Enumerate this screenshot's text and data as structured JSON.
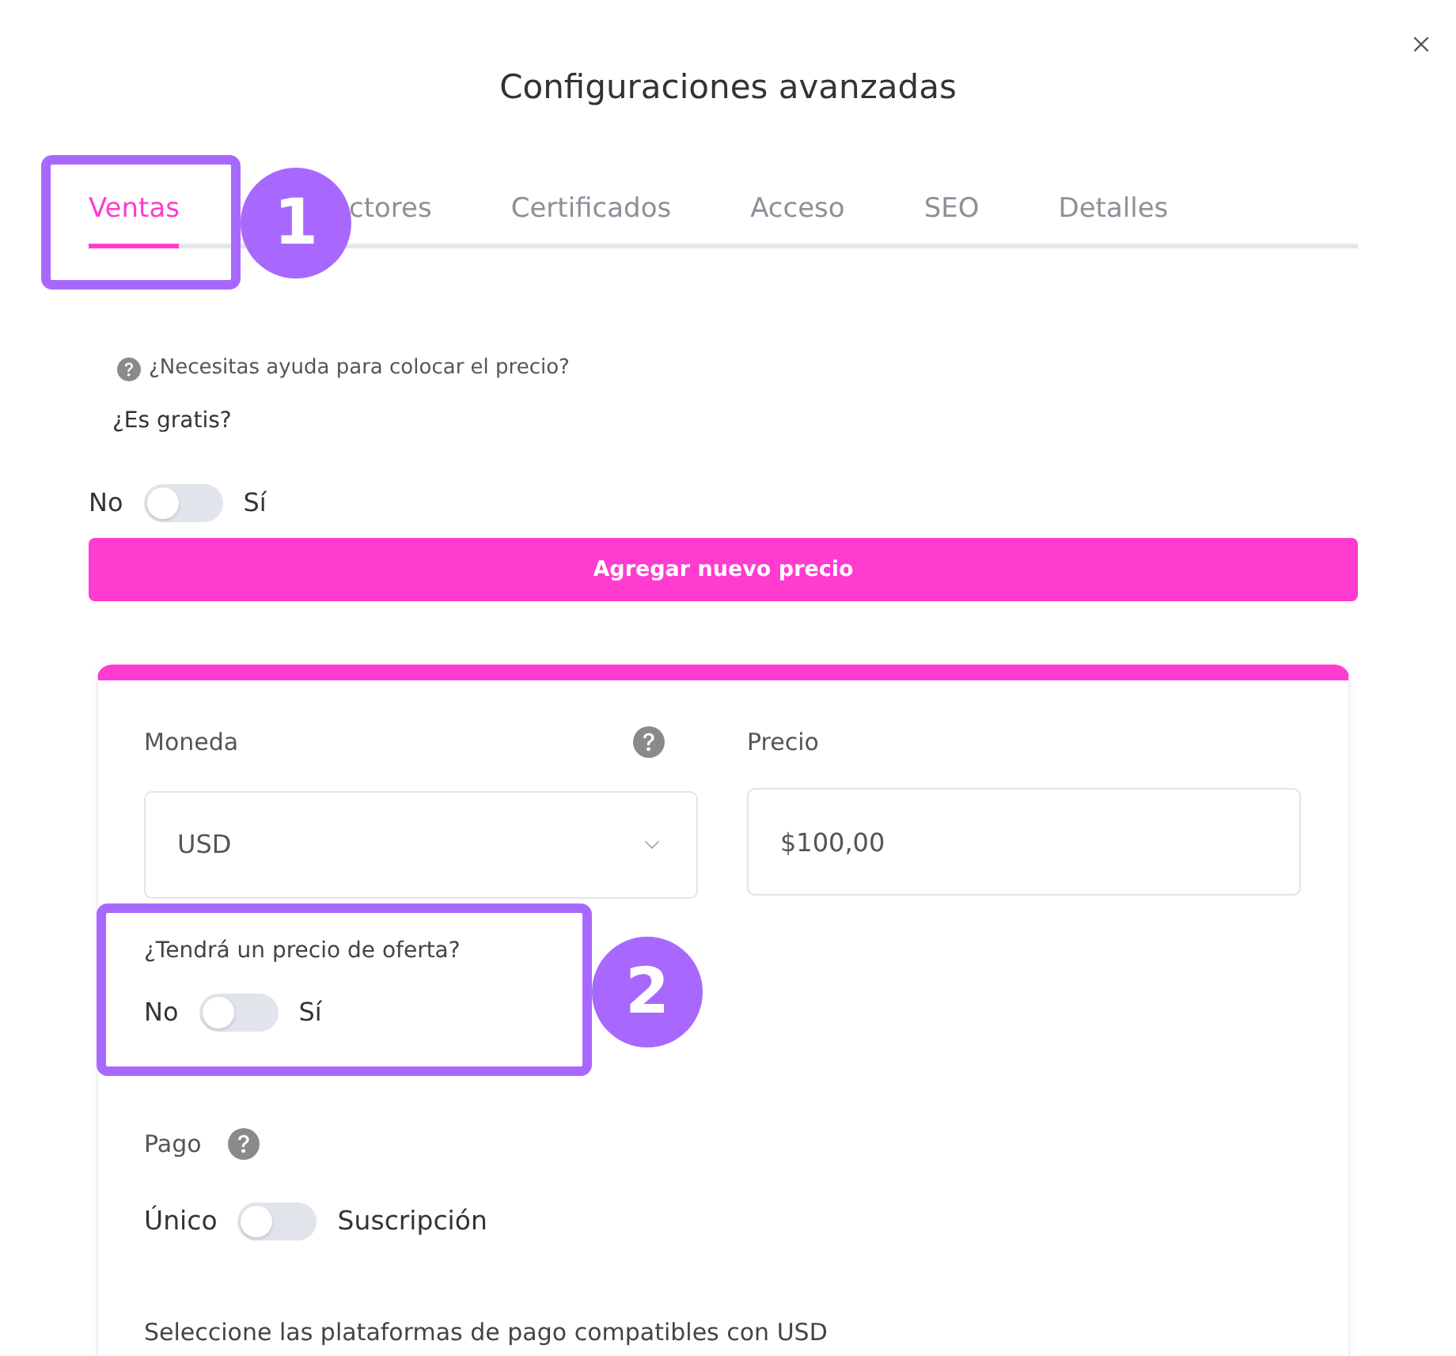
{
  "dialog": {
    "title": "Configuraciones avanzadas"
  },
  "tabs": [
    {
      "label": "Ventas",
      "selected": true,
      "callout": "1"
    },
    {
      "label": "ctores",
      "selected": false
    },
    {
      "label": "Certificados",
      "selected": false
    },
    {
      "label": "Acceso",
      "selected": false
    },
    {
      "label": "SEO",
      "selected": false
    },
    {
      "label": "Detalles",
      "selected": false
    }
  ],
  "pricing": {
    "help_link": "¿Necesitas ayuda para colocar el precio?",
    "free_question": "¿Es gratis?",
    "free_toggle": {
      "off_label": "No",
      "on_label": "Sí",
      "on": false
    },
    "add_price_button": "Agregar nuevo precio"
  },
  "price_card": {
    "currency": {
      "label": "Moneda",
      "value": "USD"
    },
    "price": {
      "label": "Precio",
      "value": "$100,00"
    },
    "offer": {
      "question": "¿Tendrá un precio de oferta?",
      "toggle": {
        "off_label": "No",
        "on_label": "Sí",
        "on": false
      },
      "callout": "2"
    },
    "payment": {
      "label": "Pago",
      "toggle": {
        "off_label": "Único",
        "on_label": "Suscripción",
        "on": false
      }
    },
    "platforms_label": "Seleccione las plataformas de pago compatibles con USD"
  }
}
